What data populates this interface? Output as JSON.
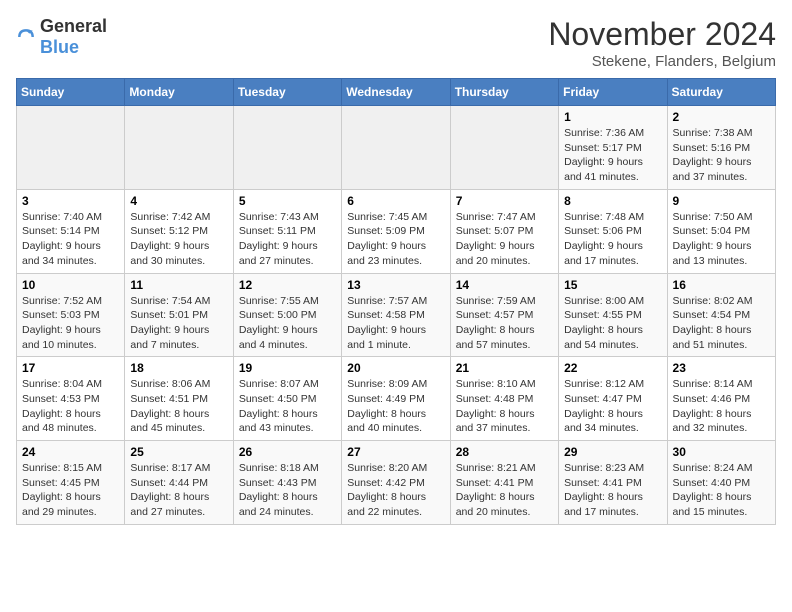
{
  "logo": {
    "text_general": "General",
    "text_blue": "Blue"
  },
  "title": "November 2024",
  "subtitle": "Stekene, Flanders, Belgium",
  "days_of_week": [
    "Sunday",
    "Monday",
    "Tuesday",
    "Wednesday",
    "Thursday",
    "Friday",
    "Saturday"
  ],
  "weeks": [
    [
      {
        "day": "",
        "info": ""
      },
      {
        "day": "",
        "info": ""
      },
      {
        "day": "",
        "info": ""
      },
      {
        "day": "",
        "info": ""
      },
      {
        "day": "",
        "info": ""
      },
      {
        "day": "1",
        "info": "Sunrise: 7:36 AM\nSunset: 5:17 PM\nDaylight: 9 hours and 41 minutes."
      },
      {
        "day": "2",
        "info": "Sunrise: 7:38 AM\nSunset: 5:16 PM\nDaylight: 9 hours and 37 minutes."
      }
    ],
    [
      {
        "day": "3",
        "info": "Sunrise: 7:40 AM\nSunset: 5:14 PM\nDaylight: 9 hours and 34 minutes."
      },
      {
        "day": "4",
        "info": "Sunrise: 7:42 AM\nSunset: 5:12 PM\nDaylight: 9 hours and 30 minutes."
      },
      {
        "day": "5",
        "info": "Sunrise: 7:43 AM\nSunset: 5:11 PM\nDaylight: 9 hours and 27 minutes."
      },
      {
        "day": "6",
        "info": "Sunrise: 7:45 AM\nSunset: 5:09 PM\nDaylight: 9 hours and 23 minutes."
      },
      {
        "day": "7",
        "info": "Sunrise: 7:47 AM\nSunset: 5:07 PM\nDaylight: 9 hours and 20 minutes."
      },
      {
        "day": "8",
        "info": "Sunrise: 7:48 AM\nSunset: 5:06 PM\nDaylight: 9 hours and 17 minutes."
      },
      {
        "day": "9",
        "info": "Sunrise: 7:50 AM\nSunset: 5:04 PM\nDaylight: 9 hours and 13 minutes."
      }
    ],
    [
      {
        "day": "10",
        "info": "Sunrise: 7:52 AM\nSunset: 5:03 PM\nDaylight: 9 hours and 10 minutes."
      },
      {
        "day": "11",
        "info": "Sunrise: 7:54 AM\nSunset: 5:01 PM\nDaylight: 9 hours and 7 minutes."
      },
      {
        "day": "12",
        "info": "Sunrise: 7:55 AM\nSunset: 5:00 PM\nDaylight: 9 hours and 4 minutes."
      },
      {
        "day": "13",
        "info": "Sunrise: 7:57 AM\nSunset: 4:58 PM\nDaylight: 9 hours and 1 minute."
      },
      {
        "day": "14",
        "info": "Sunrise: 7:59 AM\nSunset: 4:57 PM\nDaylight: 8 hours and 57 minutes."
      },
      {
        "day": "15",
        "info": "Sunrise: 8:00 AM\nSunset: 4:55 PM\nDaylight: 8 hours and 54 minutes."
      },
      {
        "day": "16",
        "info": "Sunrise: 8:02 AM\nSunset: 4:54 PM\nDaylight: 8 hours and 51 minutes."
      }
    ],
    [
      {
        "day": "17",
        "info": "Sunrise: 8:04 AM\nSunset: 4:53 PM\nDaylight: 8 hours and 48 minutes."
      },
      {
        "day": "18",
        "info": "Sunrise: 8:06 AM\nSunset: 4:51 PM\nDaylight: 8 hours and 45 minutes."
      },
      {
        "day": "19",
        "info": "Sunrise: 8:07 AM\nSunset: 4:50 PM\nDaylight: 8 hours and 43 minutes."
      },
      {
        "day": "20",
        "info": "Sunrise: 8:09 AM\nSunset: 4:49 PM\nDaylight: 8 hours and 40 minutes."
      },
      {
        "day": "21",
        "info": "Sunrise: 8:10 AM\nSunset: 4:48 PM\nDaylight: 8 hours and 37 minutes."
      },
      {
        "day": "22",
        "info": "Sunrise: 8:12 AM\nSunset: 4:47 PM\nDaylight: 8 hours and 34 minutes."
      },
      {
        "day": "23",
        "info": "Sunrise: 8:14 AM\nSunset: 4:46 PM\nDaylight: 8 hours and 32 minutes."
      }
    ],
    [
      {
        "day": "24",
        "info": "Sunrise: 8:15 AM\nSunset: 4:45 PM\nDaylight: 8 hours and 29 minutes."
      },
      {
        "day": "25",
        "info": "Sunrise: 8:17 AM\nSunset: 4:44 PM\nDaylight: 8 hours and 27 minutes."
      },
      {
        "day": "26",
        "info": "Sunrise: 8:18 AM\nSunset: 4:43 PM\nDaylight: 8 hours and 24 minutes."
      },
      {
        "day": "27",
        "info": "Sunrise: 8:20 AM\nSunset: 4:42 PM\nDaylight: 8 hours and 22 minutes."
      },
      {
        "day": "28",
        "info": "Sunrise: 8:21 AM\nSunset: 4:41 PM\nDaylight: 8 hours and 20 minutes."
      },
      {
        "day": "29",
        "info": "Sunrise: 8:23 AM\nSunset: 4:41 PM\nDaylight: 8 hours and 17 minutes."
      },
      {
        "day": "30",
        "info": "Sunrise: 8:24 AM\nSunset: 4:40 PM\nDaylight: 8 hours and 15 minutes."
      }
    ]
  ]
}
